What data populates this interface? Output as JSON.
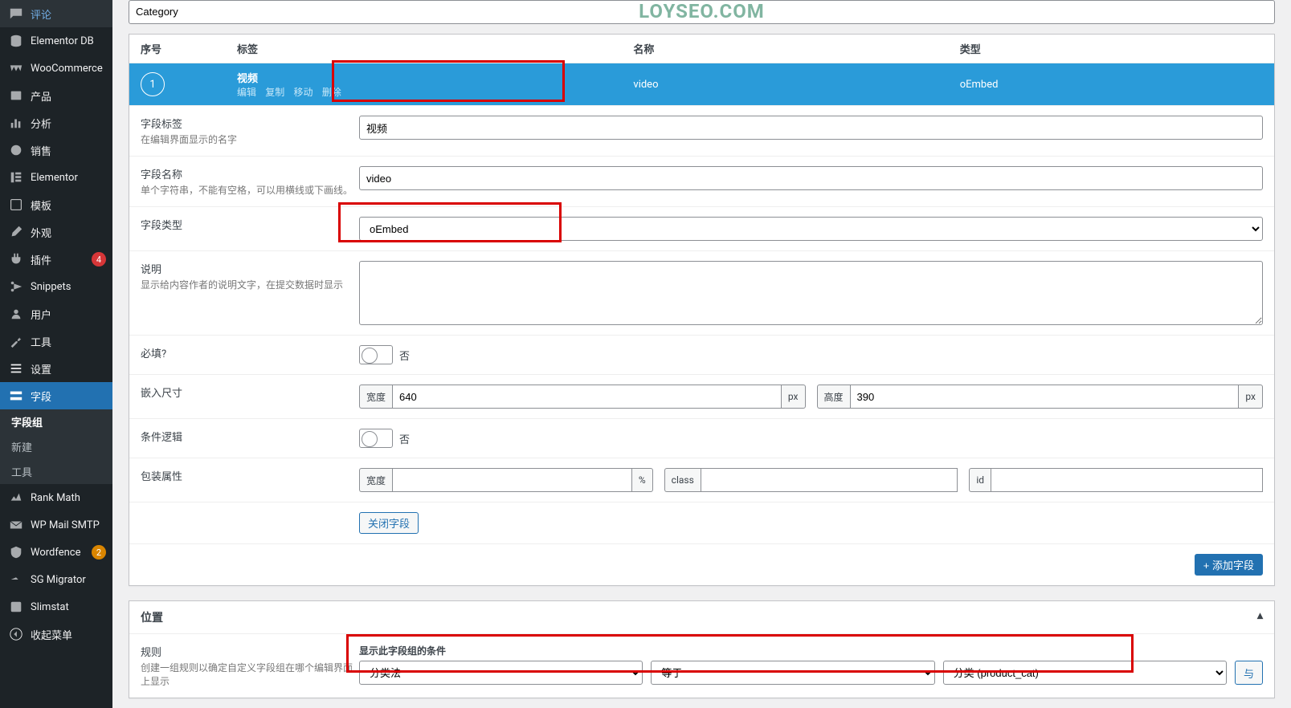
{
  "watermark": "LOYSEO.COM",
  "sidebar": {
    "items": [
      {
        "label": "评论",
        "icon": "comment"
      },
      {
        "label": "Elementor DB",
        "icon": "db"
      },
      {
        "label": "WooCommerce",
        "icon": "woo"
      },
      {
        "label": "产品",
        "icon": "products"
      },
      {
        "label": "分析",
        "icon": "stats"
      },
      {
        "label": "销售",
        "icon": "sales"
      },
      {
        "label": "Elementor",
        "icon": "elementor"
      },
      {
        "label": "模板",
        "icon": "templates"
      },
      {
        "label": "外观",
        "icon": "appearance"
      },
      {
        "label": "插件",
        "icon": "plugins",
        "badge": "4"
      },
      {
        "label": "Snippets",
        "icon": "scissors"
      },
      {
        "label": "用户",
        "icon": "users"
      },
      {
        "label": "工具",
        "icon": "tools"
      },
      {
        "label": "设置",
        "icon": "settings"
      },
      {
        "label": "字段",
        "icon": "fields",
        "active": true
      },
      {
        "label": "Rank Math",
        "icon": "rankmath"
      },
      {
        "label": "WP Mail SMTP",
        "icon": "mail"
      },
      {
        "label": "Wordfence",
        "icon": "shield",
        "badge": "2",
        "badge_orange": true
      },
      {
        "label": "SG Migrator",
        "icon": "migrate"
      },
      {
        "label": "Slimstat",
        "icon": "slim"
      },
      {
        "label": "收起菜单",
        "icon": "collapse"
      }
    ],
    "sub": [
      "字段组",
      "新建",
      "工具"
    ]
  },
  "title": "Category",
  "table": {
    "head": {
      "order": "序号",
      "label": "标签",
      "name": "名称",
      "type": "类型"
    },
    "row": {
      "num": "1",
      "label": "视频",
      "name": "video",
      "type": "oEmbed"
    },
    "actions": [
      "编辑",
      "复制",
      "移动",
      "删除"
    ]
  },
  "fields": {
    "f_label": {
      "t": "字段标签",
      "d": "在编辑界面显示的名字",
      "v": "视频"
    },
    "f_name": {
      "t": "字段名称",
      "d": "单个字符串，不能有空格，可以用横线或下画线。",
      "v": "video"
    },
    "f_type": {
      "t": "字段类型",
      "v": "oEmbed"
    },
    "f_desc": {
      "t": "说明",
      "d": "显示给内容作者的说明文字，在提交数据时显示"
    },
    "f_req": {
      "t": "必填?",
      "off": "否"
    },
    "f_embed": {
      "t": "嵌入尺寸",
      "w_label": "宽度",
      "w_val": "640",
      "w_unit": "px",
      "h_label": "高度",
      "h_val": "390",
      "h_unit": "px"
    },
    "f_logic": {
      "t": "条件逻辑",
      "off": "否"
    },
    "f_wrap": {
      "t": "包装属性",
      "w_label": "宽度",
      "w_unit": "%",
      "c_label": "class",
      "i_label": "id"
    },
    "close": "关闭字段",
    "add": "+ 添加字段"
  },
  "location": {
    "title": "位置",
    "rule_t": "规则",
    "rule_d": "创建一组规则以确定自定义字段组在哪个编辑界面上显示",
    "cond_title": "显示此字段组的条件",
    "sel1": "分类法",
    "sel2": "等于",
    "sel3": "分类 (product_cat)",
    "and": "与"
  }
}
